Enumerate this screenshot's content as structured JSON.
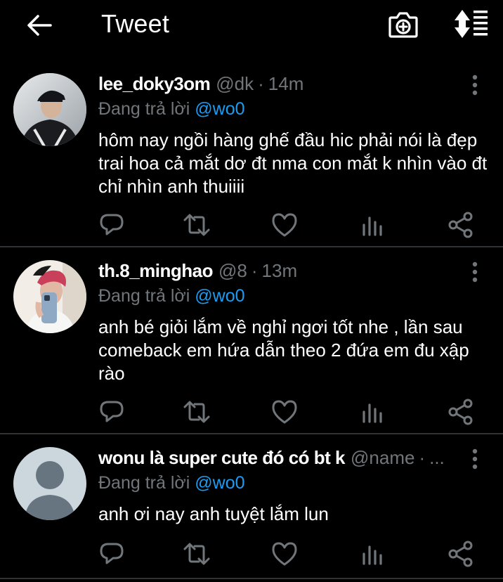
{
  "header": {
    "title": "Tweet"
  },
  "icons": {
    "back": "arrow-left-icon",
    "camera": "camera-plus-icon",
    "sort": "sort-icon",
    "more": "more-vertical-icon",
    "reply": "reply-icon",
    "retweet": "retweet-icon",
    "like": "heart-icon",
    "analytics": "analytics-icon",
    "share": "share-icon"
  },
  "colors": {
    "background": "#000000",
    "text": "#ffffff",
    "muted": "#71767b",
    "accent": "#1d9bf0",
    "divider": "#2f3336"
  },
  "replies": [
    {
      "display_name": "lee_doky3om",
      "handle": "@dk",
      "dot": "·",
      "time": "14m",
      "replying_prefix": "Đang trả lời",
      "replying_to": "@wo0",
      "text": "hôm nay ngồi hàng ghế đầu hic phải nói là đẹp trai hoa cả mắt dơ đt nma con mắt k nhìn vào đt chỉ nhìn anh thuiiii"
    },
    {
      "display_name": "th.8_minghao",
      "handle": "@8",
      "dot": "·",
      "time": "13m",
      "replying_prefix": "Đang trả lời",
      "replying_to": "@wo0",
      "text": "anh bé giỏi lắm về nghỉ ngơi tốt nhe , lần sau comeback em hứa dẫn theo 2 đứa em đu xập rào"
    },
    {
      "display_name": "wonu là super cute đó có bt k",
      "handle": "@name",
      "dot": "·",
      "time": "...",
      "replying_prefix": "Đang trả lời",
      "replying_to": "@wo0",
      "text": "anh ơi nay anh tuyệt lắm lun"
    }
  ]
}
